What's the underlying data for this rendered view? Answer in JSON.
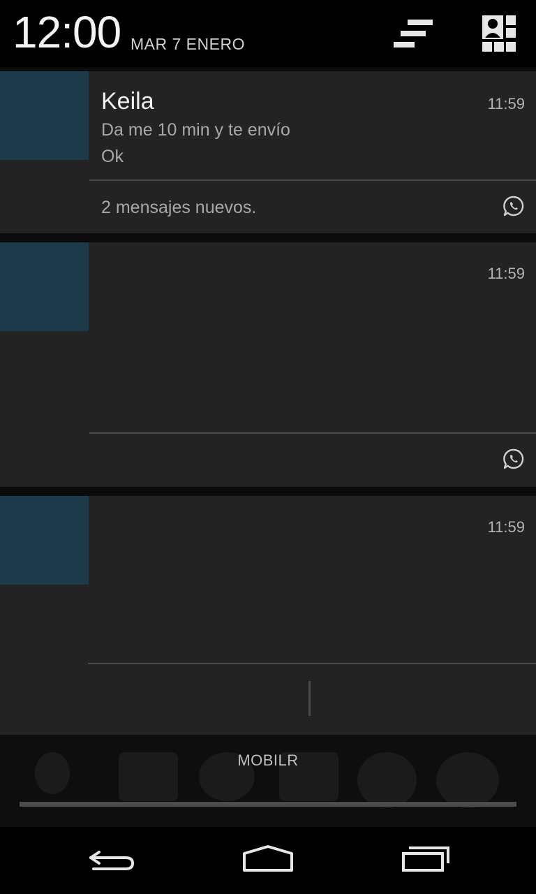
{
  "status_header": {
    "clock": "12:00",
    "date": "MAR 7 ENERO",
    "clear_icon": "clear-all-icon",
    "settings_icon": "quick-settings-icon"
  },
  "notifications": [
    {
      "title": "Keila",
      "time": "11:59",
      "lines": [
        "Da me 10 min y te envío",
        "Ok"
      ],
      "summary": "2 mensajes nuevos.",
      "app_icon": "whatsapp-icon"
    },
    {
      "title": "",
      "time": "11:59",
      "lines": [],
      "summary": "",
      "app_icon": "whatsapp-icon"
    },
    {
      "title": "",
      "time": "11:59",
      "lines": [],
      "summary": ""
    }
  ],
  "carrier": {
    "label": "MOBILR"
  },
  "navigation": {
    "back_icon": "back-icon",
    "home_icon": "home-icon",
    "recent_icon": "recent-apps-icon"
  },
  "colors": {
    "avatar_placeholder": "#1d3a4a",
    "card_background": "#232323",
    "divider": "#4a4a4a"
  }
}
